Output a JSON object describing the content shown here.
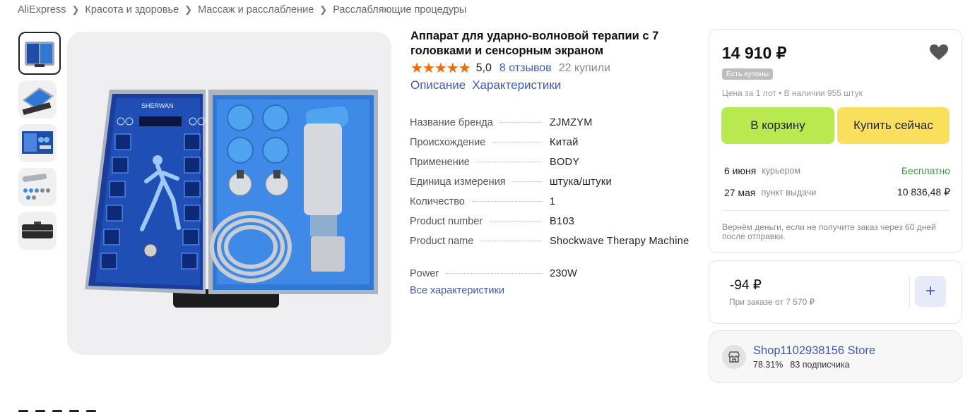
{
  "breadcrumb": {
    "items": [
      "AliExpress",
      "Красота и здоровье",
      "Массаж и расслабление",
      "Расслабляющие процедуры"
    ]
  },
  "product": {
    "title": "Аппарат для ударно-волновой терапии с 7 головками и сенсорным экраном",
    "stars": "★★★★★",
    "rating": "5,0",
    "reviews": "8 отзывов",
    "sold": "22 купили",
    "tabs": [
      "Описание",
      "Характеристики"
    ],
    "device_brand_text": "SHERWAN"
  },
  "specs": [
    {
      "key": "Название бренда",
      "value": "ZJMZYM"
    },
    {
      "key": "Происхождение",
      "value": "Китай"
    },
    {
      "key": "Применение",
      "value": "BODY"
    },
    {
      "key": "Единица измерения",
      "value": "штука/штуки"
    },
    {
      "key": "Количество",
      "value": "1"
    },
    {
      "key": "Product number",
      "value": "B103"
    },
    {
      "key": "Product name",
      "value": "Shockwave Therapy Machine"
    },
    {
      "key": "Power",
      "value": "230W"
    }
  ],
  "all_specs_link": "Все характеристики",
  "buy_box": {
    "price": "14 910 ₽",
    "coupon_badge": "Есть купоны",
    "lot_info": "Цена за 1 лот • В наличии 955 штук",
    "cart_label": "В корзину",
    "buy_label": "Купить сейчас",
    "cart_color": "#b8ea4f",
    "buy_color": "#f9df5b",
    "delivery": [
      {
        "date": "6 июня",
        "method": "курьером",
        "cost": "Бесплатно"
      },
      {
        "date": "27 мая",
        "method": "пункт выдачи",
        "cost": "10 836,48 ₽"
      }
    ],
    "refund_note": "Вернём деньги, если не получите заказ через 60 дней после отправки."
  },
  "coupon": {
    "amount": "-94 ₽",
    "condition": "При заказе от 7 570 ₽",
    "add_icon": "+"
  },
  "store": {
    "name": "Shop1102938156 Store",
    "rating": "78.31%",
    "subscribers": "83 подписчика",
    "icon": "store-icon"
  },
  "icons": {
    "breadcrumb_separator": "chevron-right-icon",
    "favorite": "heart-icon"
  }
}
